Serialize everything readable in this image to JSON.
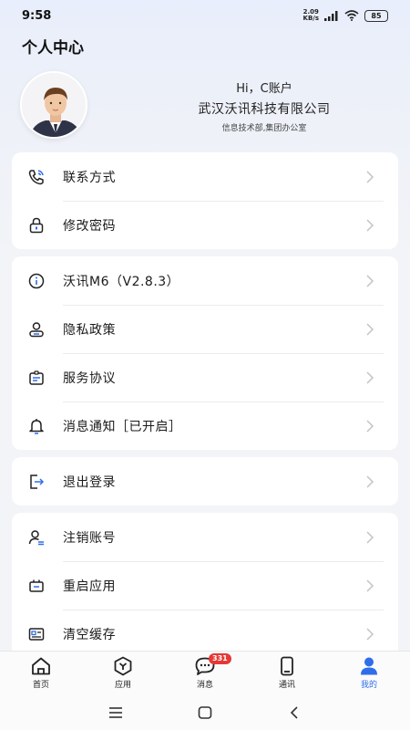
{
  "status_bar": {
    "time": "9:58",
    "net_speed": "2.09",
    "net_unit": "KB/s",
    "battery": "85"
  },
  "header": {
    "title": "个人中心"
  },
  "profile": {
    "greeting": "Hi，C账户",
    "company": "武汉沃讯科技有限公司",
    "department": "信息技术部,集团办公室"
  },
  "groups": [
    {
      "items": [
        {
          "label": "联系方式",
          "icon": "phone-icon"
        },
        {
          "label": "修改密码",
          "icon": "lock-icon"
        }
      ]
    },
    {
      "items": [
        {
          "label": "沃讯M6（V2.8.3）",
          "icon": "info-icon"
        },
        {
          "label": "隐私政策",
          "icon": "person-icon"
        },
        {
          "label": "服务协议",
          "icon": "id-card-icon"
        },
        {
          "label": "消息通知［已开启］",
          "icon": "bell-icon"
        }
      ]
    },
    {
      "items": [
        {
          "label": "退出登录",
          "icon": "logout-icon"
        }
      ]
    },
    {
      "items": [
        {
          "label": "注销账号",
          "icon": "account-cancel-icon"
        },
        {
          "label": "重启应用",
          "icon": "restart-icon"
        },
        {
          "label": "清空缓存",
          "icon": "cache-icon"
        }
      ]
    }
  ],
  "tabs": [
    {
      "label": "首页",
      "icon": "home-icon"
    },
    {
      "label": "应用",
      "icon": "apps-icon"
    },
    {
      "label": "消息",
      "icon": "message-icon",
      "badge": "331"
    },
    {
      "label": "通讯",
      "icon": "contacts-icon"
    },
    {
      "label": "我的",
      "icon": "profile-icon",
      "active": true
    }
  ],
  "colors": {
    "accent": "#2f6ee8",
    "badge": "#e53935",
    "card": "#ffffff"
  }
}
